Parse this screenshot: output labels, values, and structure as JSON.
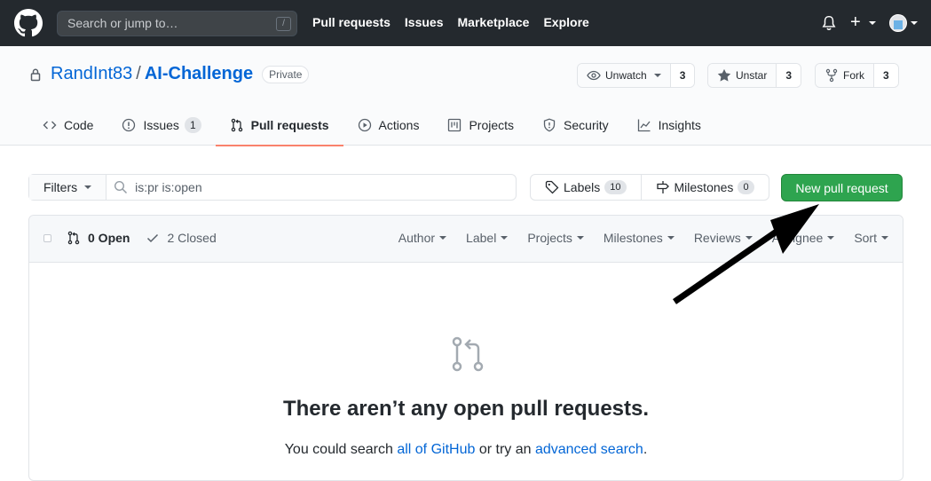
{
  "header": {
    "search_placeholder": "Search or jump to…",
    "search_hint": "/",
    "nav": [
      "Pull requests",
      "Issues",
      "Marketplace",
      "Explore"
    ]
  },
  "repo": {
    "owner": "RandInt83",
    "separator": "/",
    "name": "AI-Challenge",
    "visibility": "Private",
    "actions": {
      "watch": {
        "label": "Unwatch",
        "count": "3"
      },
      "star": {
        "label": "Unstar",
        "count": "3"
      },
      "fork": {
        "label": "Fork",
        "count": "3"
      }
    },
    "tabs": [
      {
        "label": "Code",
        "icon": "code-icon"
      },
      {
        "label": "Issues",
        "icon": "issue-icon",
        "count": "1"
      },
      {
        "label": "Pull requests",
        "icon": "pull-request-icon",
        "selected": true
      },
      {
        "label": "Actions",
        "icon": "play-icon"
      },
      {
        "label": "Projects",
        "icon": "project-icon"
      },
      {
        "label": "Security",
        "icon": "shield-icon"
      },
      {
        "label": "Insights",
        "icon": "graph-icon"
      }
    ]
  },
  "filters": {
    "button": "Filters",
    "query": "is:pr is:open",
    "labels": {
      "label": "Labels",
      "count": "10"
    },
    "milestones": {
      "label": "Milestones",
      "count": "0"
    },
    "new_pr": "New pull request"
  },
  "list": {
    "open_label": "0 Open",
    "closed_label": "2 Closed",
    "sort_options": [
      "Author",
      "Label",
      "Projects",
      "Milestones",
      "Reviews",
      "Assignee",
      "Sort"
    ],
    "empty_title": "There aren’t any open pull requests.",
    "empty_text_1": "You could search ",
    "empty_link_1": "all of GitHub",
    "empty_text_2": " or try an ",
    "empty_link_2": "advanced search",
    "empty_text_3": "."
  },
  "colors": {
    "header_bg": "#24292e",
    "link": "#0366d6",
    "primary_button": "#2ea44f",
    "tab_underline": "#f9826c"
  }
}
